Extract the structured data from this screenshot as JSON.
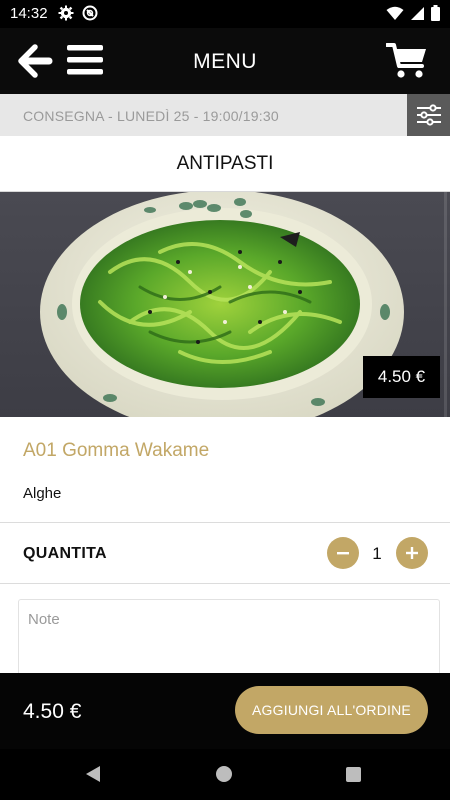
{
  "status_bar": {
    "time": "14:32"
  },
  "app_bar": {
    "title": "MENU"
  },
  "delivery": {
    "text": "CONSEGNA - LUNEDÌ 25 - 19:00/19:30"
  },
  "category": {
    "title": "ANTIPASTI"
  },
  "product": {
    "price": "4.50 €",
    "name": "A01 Gomma Wakame",
    "description": "Alghe"
  },
  "quantity": {
    "label": "QUANTITA",
    "value": "1"
  },
  "notes": {
    "placeholder": "Note",
    "value": ""
  },
  "footer": {
    "total": "4.50 €",
    "add_label": "AGGIUNGI ALL'ORDINE"
  },
  "colors": {
    "accent": "#c2a766",
    "app_bar": "#0b0b0b",
    "filter_button": "#5a5a5a"
  },
  "icons": [
    "settings-icon",
    "vpn-icon",
    "wifi-icon",
    "signal-icon",
    "battery-icon",
    "back-arrow-icon",
    "hamburger-menu-icon",
    "cart-icon",
    "filter-sliders-icon",
    "minus-icon",
    "plus-icon",
    "nav-back-icon",
    "nav-home-icon",
    "nav-recents-icon"
  ]
}
